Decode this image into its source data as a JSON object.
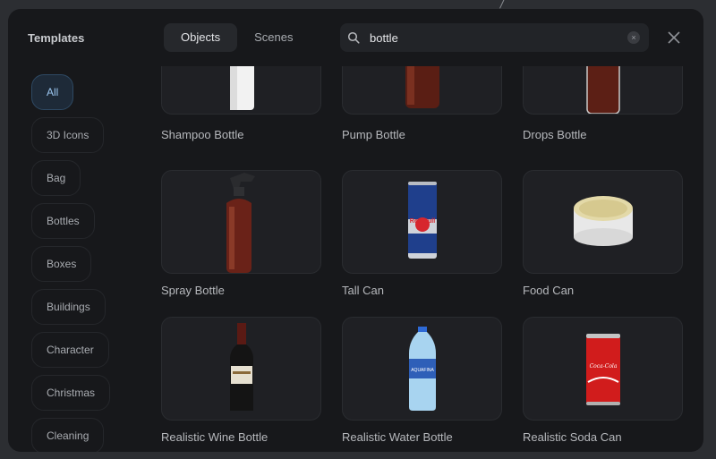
{
  "sidebar": {
    "title": "Templates",
    "categories": [
      "All",
      "3D Icons",
      "Bag",
      "Bottles",
      "Boxes",
      "Buildings",
      "Character",
      "Christmas",
      "Cleaning"
    ]
  },
  "tabs": [
    "Objects",
    "Scenes"
  ],
  "search": {
    "value": "bottle",
    "clear_label": "×"
  },
  "items": [
    "Shampoo Bottle",
    "Pump Bottle",
    "Drops Bottle",
    "Spray Bottle",
    "Tall Can",
    "Food Can",
    "Realistic Wine Bottle",
    "Realistic Water Bottle",
    "Realistic Soda Can"
  ],
  "product_marks": {
    "can_brand": "Red Bull",
    "water_brand": "AQUAFINA",
    "soda_brand": "Coca-Cola"
  },
  "colors": {
    "accent": "#9cc7f0",
    "background": "#17181b",
    "card": "#1f2024"
  }
}
